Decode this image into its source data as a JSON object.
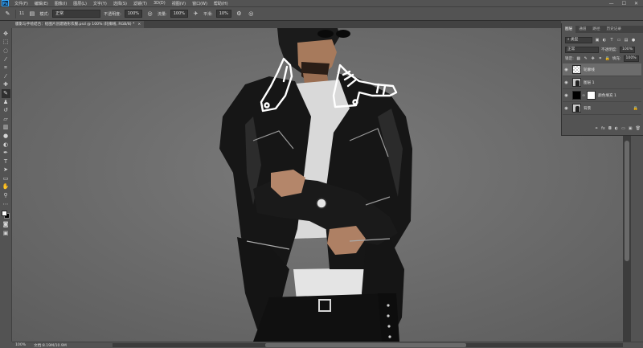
{
  "app": {
    "logo": "Ps"
  },
  "menu": [
    "文件(F)",
    "编辑(E)",
    "图像(I)",
    "图层(L)",
    "文字(Y)",
    "选择(S)",
    "滤镜(T)",
    "3D(D)",
    "视图(V)",
    "窗口(W)",
    "帮助(H)"
  ],
  "window_controls": {
    "minimize": "—",
    "maximize": "☐",
    "close": "✕"
  },
  "options": {
    "brush_size": "11",
    "mode_label": "模式:",
    "mode_value": "正常",
    "opacity_label": "不透明度:",
    "opacity_value": "100%",
    "flow_label": "流量:",
    "flow_value": "100%",
    "smoothing_label": "平滑:",
    "smoothing_value": "10%"
  },
  "document": {
    "tab_title": "膜影与手绘结合：给图片创建随形衣服.psd @ 100% (轮廓线, RGB/8) *",
    "tab_close": "×"
  },
  "status": {
    "zoom": "100%",
    "doc_info": "文档:8.19M/10.9M"
  },
  "panel": {
    "tabs": [
      "图层",
      "通道",
      "路径",
      "历史记录"
    ],
    "kind_label": "类型",
    "blend_mode": "正常",
    "opacity_label": "不透明度:",
    "opacity_value": "100%",
    "lock_label": "锁定:",
    "fill_label": "填充:",
    "fill_value": "100%",
    "layers": [
      {
        "name": "轮廓线",
        "thumb": "checker",
        "selected": true
      },
      {
        "name": "图层 1",
        "thumb": "person",
        "selected": false
      },
      {
        "name": "颜色填充 1",
        "thumb": "fill",
        "selected": false
      },
      {
        "name": "背景",
        "thumb": "person",
        "selected": false,
        "locked": true
      }
    ]
  },
  "colors": {
    "ui_bg": "#535353",
    "canvas_bg": "#6e6e6e",
    "selected_layer": "#6c6c6c",
    "jacket": "#161616",
    "shirt": "#d9d9d9",
    "outline": "#ffffff"
  }
}
